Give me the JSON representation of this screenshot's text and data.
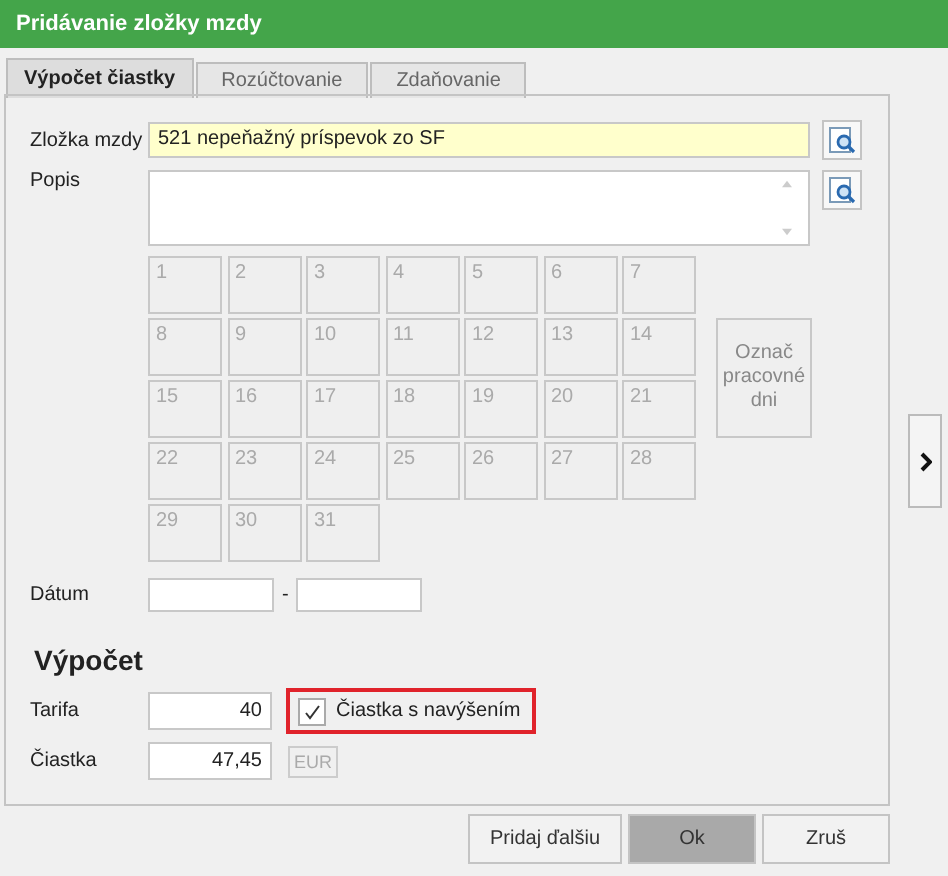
{
  "window": {
    "title": "Pridávanie zložky mzdy"
  },
  "tabs": [
    {
      "label": "Výpočet čiastky",
      "selected": true
    },
    {
      "label": "Rozúčtovanie",
      "selected": false
    },
    {
      "label": "Zdaňovanie",
      "selected": false
    }
  ],
  "zlozka": {
    "label": "Zložka mzdy",
    "value": "521  nepeňažný príspevok zo SF"
  },
  "popis": {
    "label": "Popis"
  },
  "days": [
    "1",
    "2",
    "3",
    "4",
    "5",
    "6",
    "7",
    "8",
    "9",
    "10",
    "11",
    "12",
    "13",
    "14",
    "15",
    "16",
    "17",
    "18",
    "19",
    "20",
    "21",
    "22",
    "23",
    "24",
    "25",
    "26",
    "27",
    "28",
    "29",
    "30",
    "31"
  ],
  "mark_days_button": "Označ pracovné dni",
  "datum": {
    "label": "Dátum",
    "separator": "-"
  },
  "section": "Výpočet",
  "tarifa": {
    "label": "Tarifa",
    "value": "40"
  },
  "increase": {
    "label": "Čiastka s navýšením",
    "checked": true
  },
  "ciastka": {
    "label": "Čiastka",
    "value": "47,45",
    "currency": "EUR"
  },
  "buttons": [
    {
      "label": "Pridaj ďalšiu",
      "selected": false
    },
    {
      "label": "Ok",
      "selected": true
    },
    {
      "label": "Zruš",
      "selected": false
    }
  ]
}
